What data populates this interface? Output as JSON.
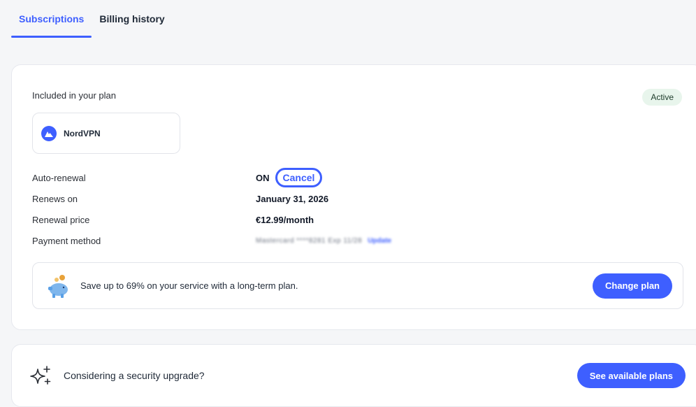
{
  "tabs": [
    {
      "label": "Subscriptions",
      "active": true
    },
    {
      "label": "Billing history",
      "active": false
    }
  ],
  "plan": {
    "included_label": "Included in your plan",
    "status": "Active",
    "product_name": "NordVPN",
    "details": {
      "auto_renewal": {
        "label": "Auto-renewal",
        "value": "ON",
        "cancel_label": "Cancel"
      },
      "renews_on": {
        "label": "Renews on",
        "value": "January 31, 2026"
      },
      "renewal_price": {
        "label": "Renewal price",
        "value": "€12.99/month"
      },
      "payment_method": {
        "label": "Payment method",
        "value": "Mastercard ****8281 Exp 11/28",
        "update_label": "Update"
      }
    },
    "promo": {
      "text": "Save up to 69% on your service with a long-term plan.",
      "button_label": "Change plan"
    }
  },
  "upgrade": {
    "text": "Considering a security upgrade?",
    "button_label": "See available plans"
  },
  "colors": {
    "accent": "#3e5fff",
    "active_badge_bg": "#e8f5ec",
    "page_bg": "#f5f6f8"
  },
  "icons": {
    "product": "nordvpn-logo-icon",
    "promo": "piggy-bank-icon",
    "upgrade": "sparkle-icon"
  }
}
